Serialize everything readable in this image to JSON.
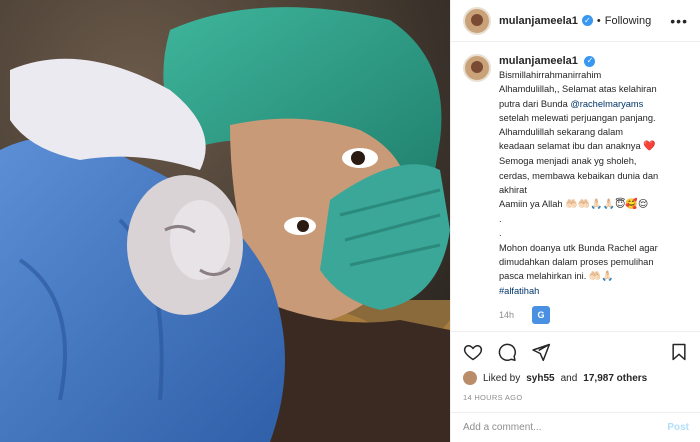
{
  "post": {
    "username": "mulanjameela1",
    "verified_mark": "✓",
    "dot": "•",
    "follow_status": "Following",
    "more": "•••",
    "caption_lines": [
      "Bismillahirrahmanirrahim",
      "Alhamdulillah,, Selamat atas kelahiran",
      "putra dari Bunda ",
      "setelah melewati perjuangan panjang.",
      "Alhamdulillah sekarang dalam",
      "keadaan selamat ibu dan anaknya ",
      "Semoga menjadi anak yg sholeh,",
      "cerdas, membawa kebaikan dunia dan",
      "akhirat",
      "Aamiin ya Allah ",
      ".",
      ".",
      "Mohon doanya utk Bunda Rachel agar",
      "dimudahkan dalam proses pemulihan",
      "pasca melahirkan ini. "
    ],
    "mention": "@rachelmaryams",
    "heart_emoji": "❤️",
    "allah_emojis": "🤲🏻🤲🏻🙏🏻🙏🏻😇🥰😌",
    "end_emojis": "🤲🏻🙏🏻",
    "hashtag": "#alfatihah",
    "caption_time": "14h",
    "translate_label": "G",
    "liked_by_prefix": "Liked by",
    "liked_by_user": "syh55",
    "liked_and": "and",
    "likes_count": "17,987 others",
    "timestamp": "14 HOURS AGO",
    "comment_placeholder": "Add a comment...",
    "post_button": "Post"
  },
  "icons": {
    "like": "heart-icon",
    "comment": "comment-icon",
    "share": "share-icon",
    "save": "bookmark-icon"
  },
  "colors": {
    "link": "#003569",
    "verified": "#3897f0",
    "post_button": "#b2dffc",
    "heart": "#ed4956"
  }
}
